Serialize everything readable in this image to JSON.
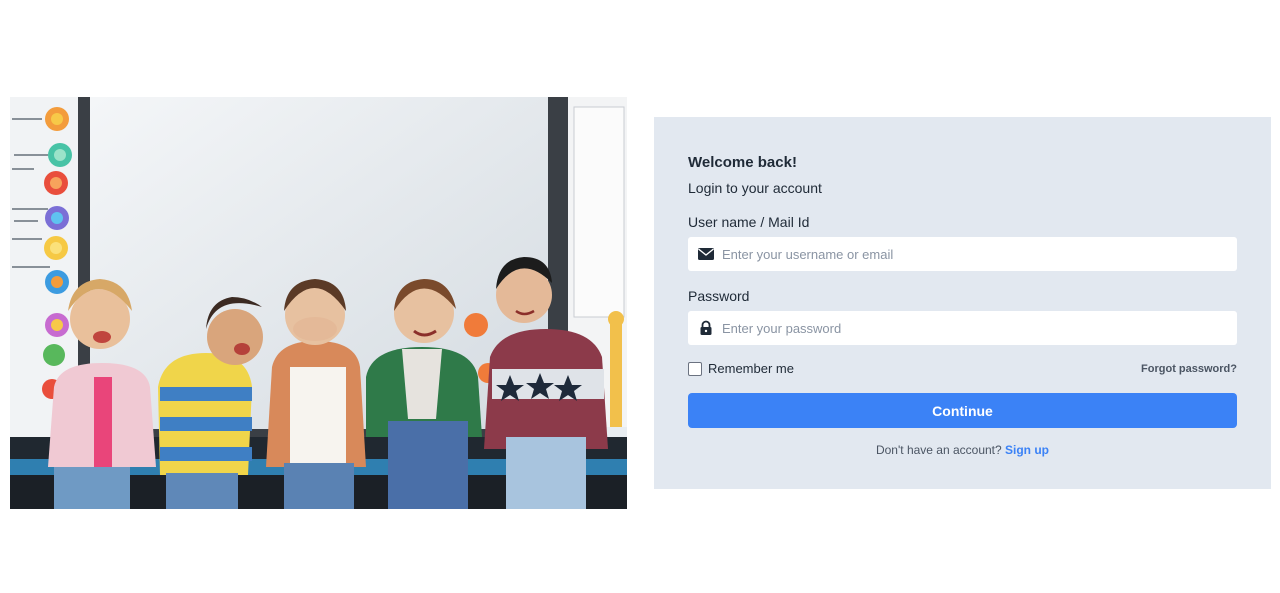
{
  "hero_image": {
    "icon": "kids-classroom-photo"
  },
  "login": {
    "title": "Welcome back!",
    "subtitle": "Login to your account",
    "username": {
      "label": "User name / Mail Id",
      "placeholder": "Enter your username or email",
      "value": "",
      "icon": "envelope-icon"
    },
    "password": {
      "label": "Password",
      "placeholder": "Enter your password",
      "value": "",
      "icon": "lock-icon"
    },
    "remember_label": "Remember me",
    "remember_checked": false,
    "forgot_label": "Forgot password?",
    "continue_label": "Continue",
    "signup_prompt": "Don't have an account?",
    "signup_link": "Sign up"
  },
  "colors": {
    "card_bg": "#e2e8f0",
    "primary": "#3b82f6",
    "text": "#1f2a37"
  }
}
